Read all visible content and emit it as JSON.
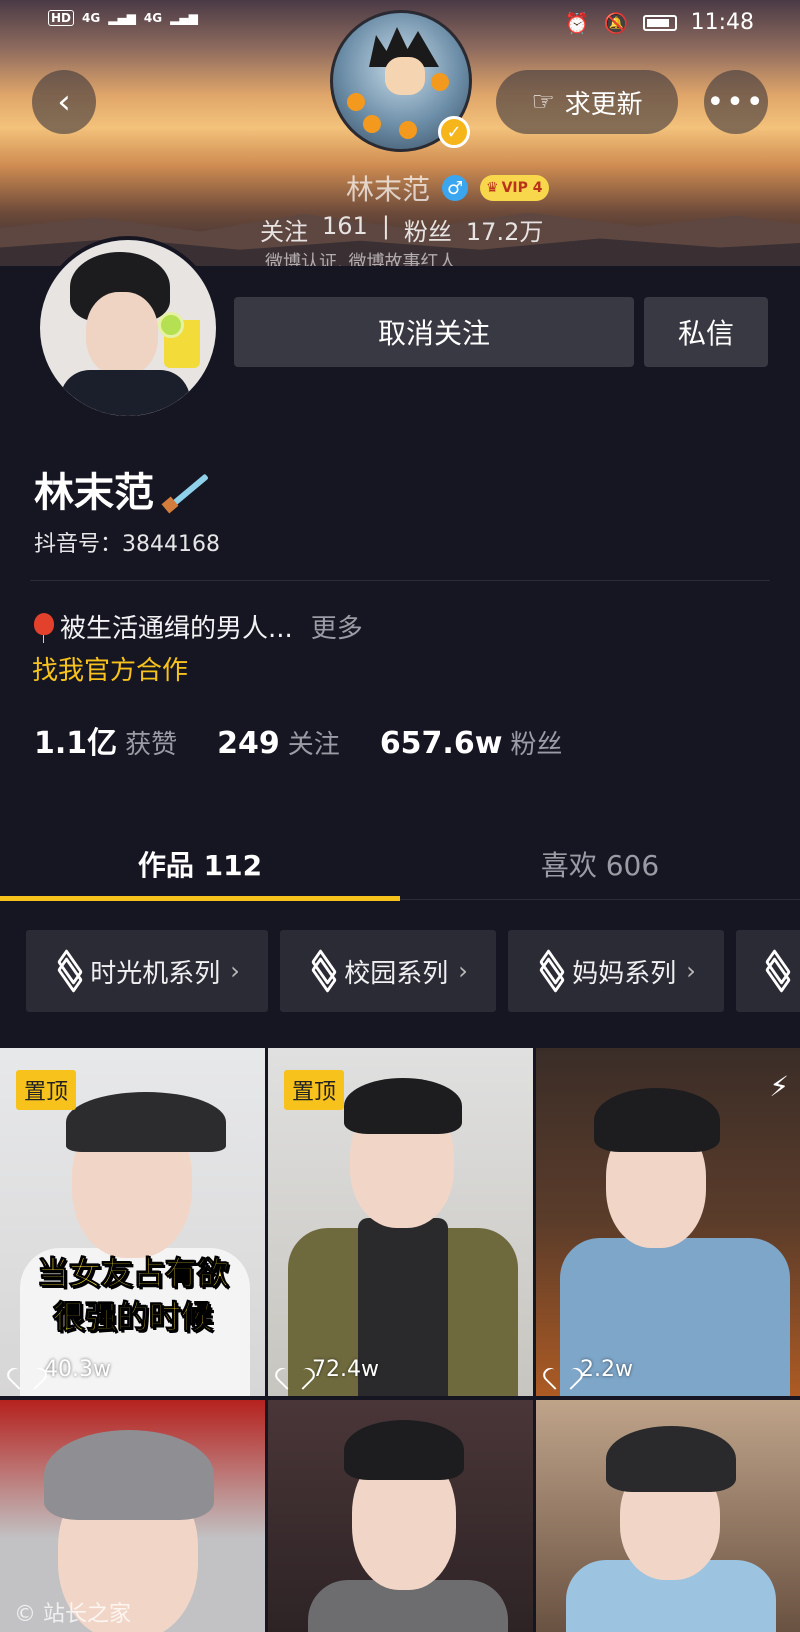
{
  "status_bar": {
    "left_badges": [
      "HD",
      "4G",
      "4G"
    ],
    "time": "11:48"
  },
  "header": {
    "back_icon": "chevron-left-icon",
    "update_button": "求更新",
    "more_icon": "more-icon",
    "top_name": "林末范",
    "vip_label": "VIP 4",
    "following_label": "关注",
    "following_count": "161",
    "fans_label": "粉丝",
    "fans_count": "17.2万",
    "sub_text": "微博认证, 微博故事红人"
  },
  "profile": {
    "unfollow_button": "取消关注",
    "message_button": "私信",
    "name": "林末范",
    "douyin_id": "抖音号：3844168",
    "bio": "被生活通缉的男人...",
    "bio_more": "更多",
    "cooperate_link": "找我官方合作",
    "stats": [
      {
        "num": "1.1亿",
        "label": "获赞"
      },
      {
        "num": "249",
        "label": "关注"
      },
      {
        "num": "657.6w",
        "label": "粉丝"
      }
    ]
  },
  "tabs": {
    "works": "作品 112",
    "likes": "喜欢 606"
  },
  "series": [
    {
      "label": "时光机系列"
    },
    {
      "label": "校园系列"
    },
    {
      "label": "妈妈系列"
    }
  ],
  "videos": [
    {
      "pinned": "置顶",
      "likes": "40.3w",
      "caption_line1": "当女友占有欲",
      "caption_line2": "很强的时候"
    },
    {
      "pinned": "置顶",
      "likes": "72.4w"
    },
    {
      "likes": "2.2w"
    }
  ],
  "watermark": "站长之家",
  "colors": {
    "accent": "#f6c21b",
    "background": "#161622",
    "button": "#393943"
  }
}
